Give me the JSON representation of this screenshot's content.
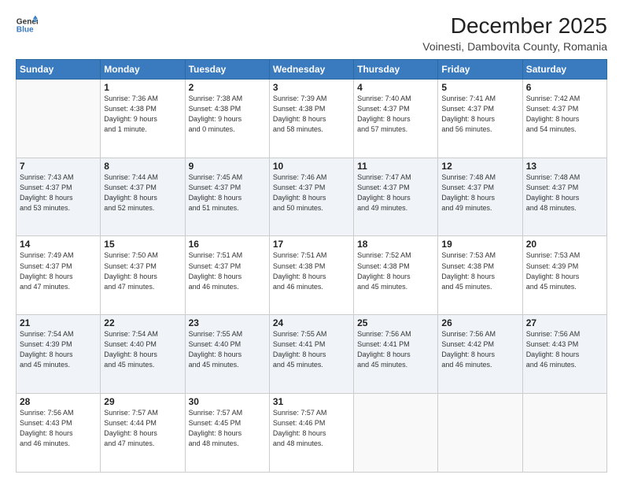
{
  "header": {
    "logo_line1": "General",
    "logo_line2": "Blue",
    "title": "December 2025",
    "subtitle": "Voinesti, Dambovita County, Romania"
  },
  "days_of_week": [
    "Sunday",
    "Monday",
    "Tuesday",
    "Wednesday",
    "Thursday",
    "Friday",
    "Saturday"
  ],
  "weeks": [
    [
      {
        "day": "",
        "info": ""
      },
      {
        "day": "1",
        "info": "Sunrise: 7:36 AM\nSunset: 4:38 PM\nDaylight: 9 hours\nand 1 minute."
      },
      {
        "day": "2",
        "info": "Sunrise: 7:38 AM\nSunset: 4:38 PM\nDaylight: 9 hours\nand 0 minutes."
      },
      {
        "day": "3",
        "info": "Sunrise: 7:39 AM\nSunset: 4:38 PM\nDaylight: 8 hours\nand 58 minutes."
      },
      {
        "day": "4",
        "info": "Sunrise: 7:40 AM\nSunset: 4:37 PM\nDaylight: 8 hours\nand 57 minutes."
      },
      {
        "day": "5",
        "info": "Sunrise: 7:41 AM\nSunset: 4:37 PM\nDaylight: 8 hours\nand 56 minutes."
      },
      {
        "day": "6",
        "info": "Sunrise: 7:42 AM\nSunset: 4:37 PM\nDaylight: 8 hours\nand 54 minutes."
      }
    ],
    [
      {
        "day": "7",
        "info": "Sunrise: 7:43 AM\nSunset: 4:37 PM\nDaylight: 8 hours\nand 53 minutes."
      },
      {
        "day": "8",
        "info": "Sunrise: 7:44 AM\nSunset: 4:37 PM\nDaylight: 8 hours\nand 52 minutes."
      },
      {
        "day": "9",
        "info": "Sunrise: 7:45 AM\nSunset: 4:37 PM\nDaylight: 8 hours\nand 51 minutes."
      },
      {
        "day": "10",
        "info": "Sunrise: 7:46 AM\nSunset: 4:37 PM\nDaylight: 8 hours\nand 50 minutes."
      },
      {
        "day": "11",
        "info": "Sunrise: 7:47 AM\nSunset: 4:37 PM\nDaylight: 8 hours\nand 49 minutes."
      },
      {
        "day": "12",
        "info": "Sunrise: 7:48 AM\nSunset: 4:37 PM\nDaylight: 8 hours\nand 49 minutes."
      },
      {
        "day": "13",
        "info": "Sunrise: 7:48 AM\nSunset: 4:37 PM\nDaylight: 8 hours\nand 48 minutes."
      }
    ],
    [
      {
        "day": "14",
        "info": "Sunrise: 7:49 AM\nSunset: 4:37 PM\nDaylight: 8 hours\nand 47 minutes."
      },
      {
        "day": "15",
        "info": "Sunrise: 7:50 AM\nSunset: 4:37 PM\nDaylight: 8 hours\nand 47 minutes."
      },
      {
        "day": "16",
        "info": "Sunrise: 7:51 AM\nSunset: 4:37 PM\nDaylight: 8 hours\nand 46 minutes."
      },
      {
        "day": "17",
        "info": "Sunrise: 7:51 AM\nSunset: 4:38 PM\nDaylight: 8 hours\nand 46 minutes."
      },
      {
        "day": "18",
        "info": "Sunrise: 7:52 AM\nSunset: 4:38 PM\nDaylight: 8 hours\nand 45 minutes."
      },
      {
        "day": "19",
        "info": "Sunrise: 7:53 AM\nSunset: 4:38 PM\nDaylight: 8 hours\nand 45 minutes."
      },
      {
        "day": "20",
        "info": "Sunrise: 7:53 AM\nSunset: 4:39 PM\nDaylight: 8 hours\nand 45 minutes."
      }
    ],
    [
      {
        "day": "21",
        "info": "Sunrise: 7:54 AM\nSunset: 4:39 PM\nDaylight: 8 hours\nand 45 minutes."
      },
      {
        "day": "22",
        "info": "Sunrise: 7:54 AM\nSunset: 4:40 PM\nDaylight: 8 hours\nand 45 minutes."
      },
      {
        "day": "23",
        "info": "Sunrise: 7:55 AM\nSunset: 4:40 PM\nDaylight: 8 hours\nand 45 minutes."
      },
      {
        "day": "24",
        "info": "Sunrise: 7:55 AM\nSunset: 4:41 PM\nDaylight: 8 hours\nand 45 minutes."
      },
      {
        "day": "25",
        "info": "Sunrise: 7:56 AM\nSunset: 4:41 PM\nDaylight: 8 hours\nand 45 minutes."
      },
      {
        "day": "26",
        "info": "Sunrise: 7:56 AM\nSunset: 4:42 PM\nDaylight: 8 hours\nand 46 minutes."
      },
      {
        "day": "27",
        "info": "Sunrise: 7:56 AM\nSunset: 4:43 PM\nDaylight: 8 hours\nand 46 minutes."
      }
    ],
    [
      {
        "day": "28",
        "info": "Sunrise: 7:56 AM\nSunset: 4:43 PM\nDaylight: 8 hours\nand 46 minutes."
      },
      {
        "day": "29",
        "info": "Sunrise: 7:57 AM\nSunset: 4:44 PM\nDaylight: 8 hours\nand 47 minutes."
      },
      {
        "day": "30",
        "info": "Sunrise: 7:57 AM\nSunset: 4:45 PM\nDaylight: 8 hours\nand 48 minutes."
      },
      {
        "day": "31",
        "info": "Sunrise: 7:57 AM\nSunset: 4:46 PM\nDaylight: 8 hours\nand 48 minutes."
      },
      {
        "day": "",
        "info": ""
      },
      {
        "day": "",
        "info": ""
      },
      {
        "day": "",
        "info": ""
      }
    ]
  ]
}
